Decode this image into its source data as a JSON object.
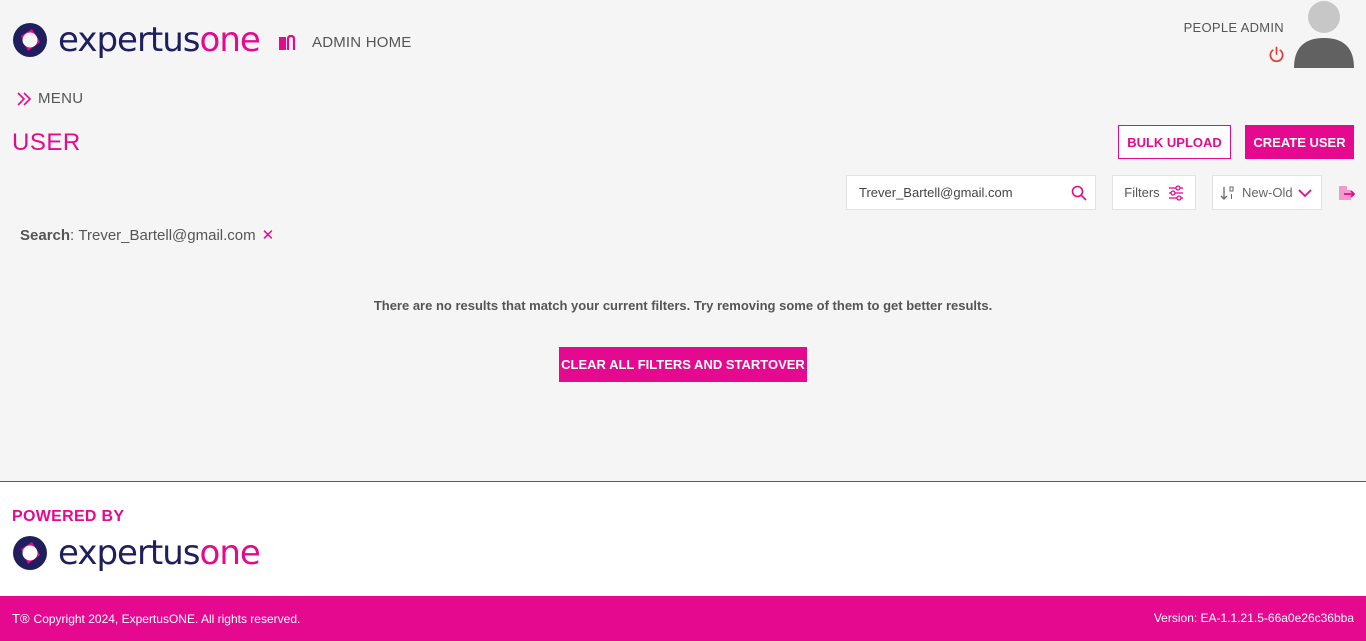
{
  "brand": {
    "word_part1": "expertus",
    "word_part2": "one",
    "primary": "#e5098f",
    "navy": "#1f1f5e"
  },
  "header": {
    "admin_home_label": "ADMIN HOME",
    "role_label": "PEOPLE ADMIN",
    "menu_label": "MENU",
    "icons": [
      "home-icon",
      "power-icon",
      "avatar",
      "menu-chevron-icon"
    ]
  },
  "page": {
    "title": "USER",
    "bulk_upload_label": "BULK UPLOAD",
    "create_user_label": "CREATE USER"
  },
  "toolbar": {
    "search_value": "Trever_Bartell@gmail.com",
    "filters_label": "Filters",
    "sort_value": "New-Old"
  },
  "active_filter": {
    "label": "Search",
    "separator": ":",
    "value": "Trever_Bartell@gmail.com",
    "remove_glyph": "✕"
  },
  "results": {
    "empty_message": "There are no results that match your current filters. Try removing some of them to get better results.",
    "clear_label": "CLEAR ALL FILTERS AND STARTOVER"
  },
  "footer": {
    "powered_by": "POWERED BY",
    "tm_mark": "T®",
    "copyright": "Copyright 2024, ExpertusONE. All rights reserved.",
    "version": "Version: EA-1.1.21.5-66a0e26c36bba"
  }
}
